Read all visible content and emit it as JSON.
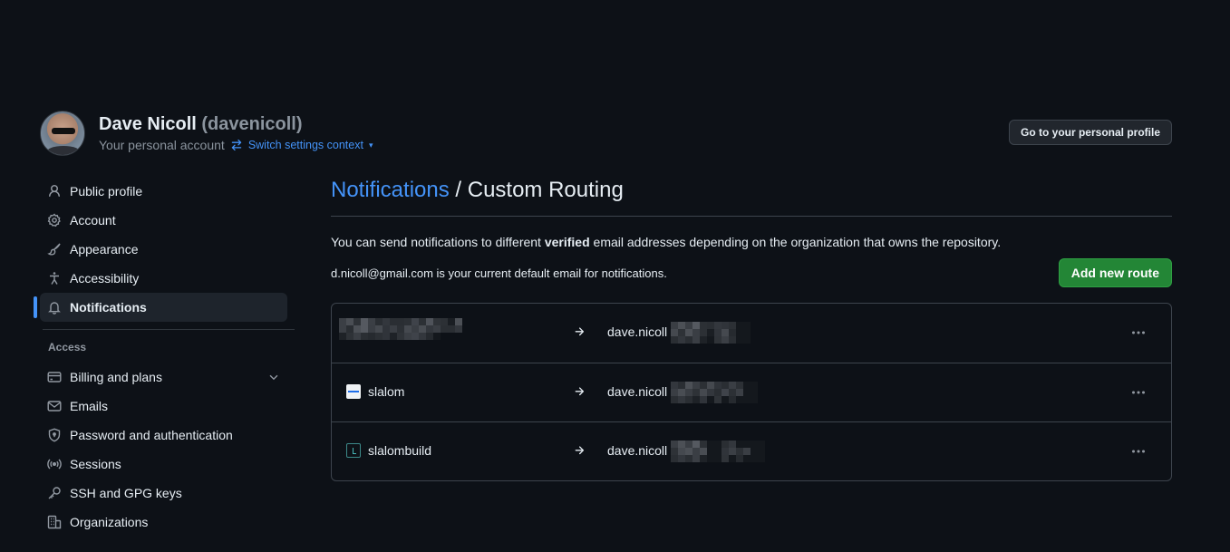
{
  "header": {
    "display_name": "Dave Nicoll",
    "username": "(davenicoll)",
    "account_type": "Your personal account",
    "switch_label": "Switch settings context",
    "profile_button": "Go to your personal profile"
  },
  "sidebar": {
    "items": [
      {
        "label": "Public profile",
        "icon": "person-icon"
      },
      {
        "label": "Account",
        "icon": "gear-icon"
      },
      {
        "label": "Appearance",
        "icon": "paintbrush-icon"
      },
      {
        "label": "Accessibility",
        "icon": "accessibility-icon"
      },
      {
        "label": "Notifications",
        "icon": "bell-icon",
        "active": true
      }
    ],
    "access_heading": "Access",
    "access_items": [
      {
        "label": "Billing and plans",
        "icon": "credit-card-icon"
      },
      {
        "label": "Emails",
        "icon": "mail-icon"
      },
      {
        "label": "Password and authentication",
        "icon": "shield-lock-icon"
      },
      {
        "label": "Sessions",
        "icon": "broadcast-icon"
      },
      {
        "label": "SSH and GPG keys",
        "icon": "key-icon"
      },
      {
        "label": "Organizations",
        "icon": "organization-icon"
      }
    ]
  },
  "main": {
    "breadcrumb": "Notifications",
    "title": " / Custom Routing",
    "desc_before": "You can send notifications to different ",
    "desc_bold": "verified",
    "desc_after": " email addresses depending on the organization that owns the repository.",
    "default_email_text": "d.nicoll@gmail.com is your current default email for notifications.",
    "add_button": "Add new route"
  },
  "routes": [
    {
      "org": "",
      "email_prefix": "dave.nicoll"
    },
    {
      "org": "slalom",
      "email_prefix": "dave.nicoll"
    },
    {
      "org": "slalombuild",
      "email_prefix": "dave.nicoll"
    }
  ],
  "colors": {
    "background": "#0d1117",
    "accent": "#4493f8",
    "primary_button": "#238636",
    "border": "#3d444d"
  }
}
